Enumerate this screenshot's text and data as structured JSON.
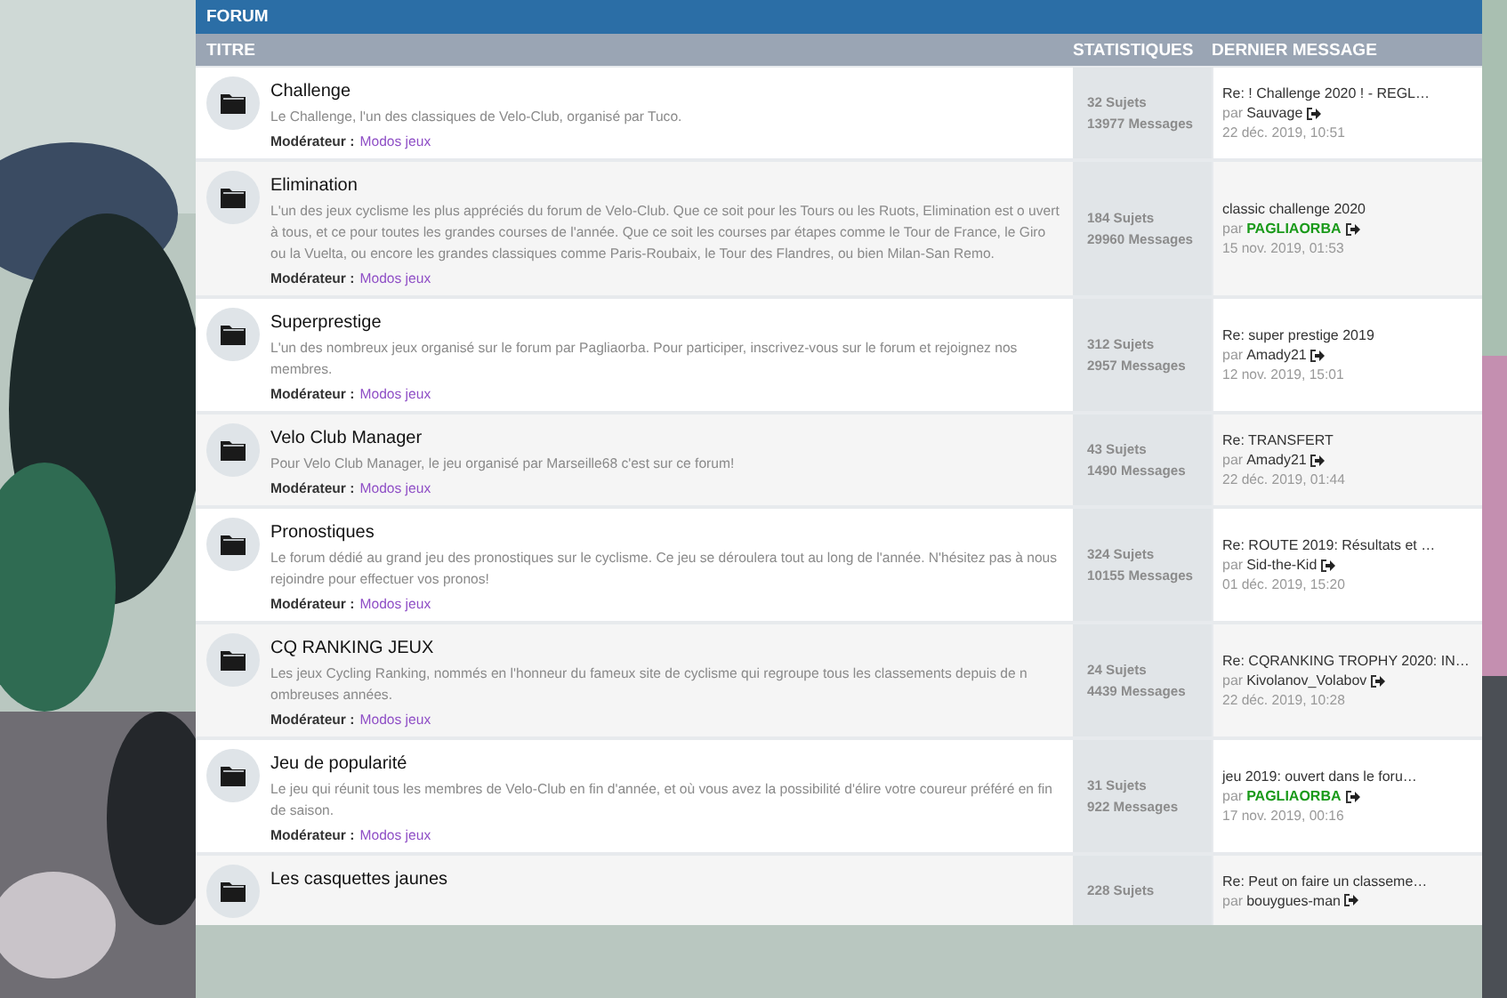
{
  "header": {
    "title": "FORUM"
  },
  "columns": {
    "title": "TITRE",
    "stats": "STATISTIQUES",
    "last": "DERNIER MESSAGE"
  },
  "forums": [
    {
      "title": "Challenge",
      "description": "Le Challenge, l'un des classiques de Velo-Club, organisé par Tuco.",
      "moderator_label": "Modérateur :",
      "moderator": "Modos jeux",
      "topics": "32 Sujets",
      "posts": "13977 Messages",
      "last": {
        "title": "Re: ! Challenge 2020 ! - REGL…",
        "by": "par",
        "author": "Sauvage",
        "highlighted": false,
        "date": "22 déc. 2019, 10:51"
      }
    },
    {
      "title": "Elimination",
      "description": "L'un des jeux cyclisme les plus appréciés du forum de Velo-Club. Que ce soit pour les Tours ou les Ruots, Elimination est o uvert à tous, et ce pour toutes les grandes courses de l'année. Que ce soit les courses par étapes comme le Tour de France, le Giro ou la Vuelta, ou encore les grandes classiques comme Paris-Roubaix, le Tour des Flandres, ou bien Milan-San Remo.",
      "moderator_label": "Modérateur :",
      "moderator": "Modos jeux",
      "topics": "184 Sujets",
      "posts": "29960 Messages",
      "last": {
        "title": "classic challenge 2020",
        "by": "par",
        "author": "PAGLIAORBA",
        "highlighted": true,
        "date": "15 nov. 2019, 01:53"
      }
    },
    {
      "title": "Superprestige",
      "description": "L'un des nombreux jeux organisé sur le forum par Pagliaorba. Pour participer, inscrivez-vous sur le forum et rejoignez nos membres.",
      "moderator_label": "Modérateur :",
      "moderator": "Modos jeux",
      "topics": "312 Sujets",
      "posts": "2957 Messages",
      "last": {
        "title": "Re: super prestige 2019",
        "by": "par",
        "author": "Amady21",
        "highlighted": false,
        "date": "12 nov. 2019, 15:01"
      }
    },
    {
      "title": "Velo Club Manager",
      "description": "Pour Velo Club Manager, le jeu organisé par Marseille68 c'est sur ce forum!",
      "moderator_label": "Modérateur :",
      "moderator": "Modos jeux",
      "topics": "43 Sujets",
      "posts": "1490 Messages",
      "last": {
        "title": "Re: TRANSFERT",
        "by": "par",
        "author": "Amady21",
        "highlighted": false,
        "date": "22 déc. 2019, 01:44"
      }
    },
    {
      "title": "Pronostiques",
      "description": "Le forum dédié au grand jeu des pronostiques sur le cyclisme. Ce jeu se déroulera tout au long de l'année. N'hésitez pas à nous rejoindre pour effectuer vos pronos!",
      "moderator_label": "Modérateur :",
      "moderator": "Modos jeux",
      "topics": "324 Sujets",
      "posts": "10155 Messages",
      "last": {
        "title": "Re: ROUTE 2019: Résultats et …",
        "by": "par",
        "author": "Sid-the-Kid",
        "highlighted": false,
        "date": "01 déc. 2019, 15:20"
      }
    },
    {
      "title": "CQ RANKING JEUX",
      "description": "Les jeux Cycling Ranking, nommés en l'honneur du fameux site de cyclisme qui regroupe tous les classements depuis de n ombreuses années.",
      "moderator_label": "Modérateur :",
      "moderator": "Modos jeux",
      "topics": "24 Sujets",
      "posts": "4439 Messages",
      "last": {
        "title": "Re: CQRANKING TROPHY 2020: IN…",
        "by": "par",
        "author": "Kivolanov_Volabov",
        "highlighted": false,
        "date": "22 déc. 2019, 10:28"
      }
    },
    {
      "title": "Jeu de popularité",
      "description": "Le jeu qui réunit tous les membres de Velo-Club en fin d'année, et où vous avez la possibilité d'élire votre coureur préféré en fin de saison.",
      "moderator_label": "Modérateur :",
      "moderator": "Modos jeux",
      "topics": "31 Sujets",
      "posts": "922 Messages",
      "last": {
        "title": "jeu 2019: ouvert dans le foru…",
        "by": "par",
        "author": "PAGLIAORBA",
        "highlighted": true,
        "date": "17 nov. 2019, 00:16"
      }
    },
    {
      "title": "Les casquettes jaunes",
      "topics": "228 Sujets",
      "last": {
        "title": "Re: Peut on faire un classeme…",
        "by": "par",
        "author": "bouygues-man",
        "highlighted": false
      }
    }
  ]
}
